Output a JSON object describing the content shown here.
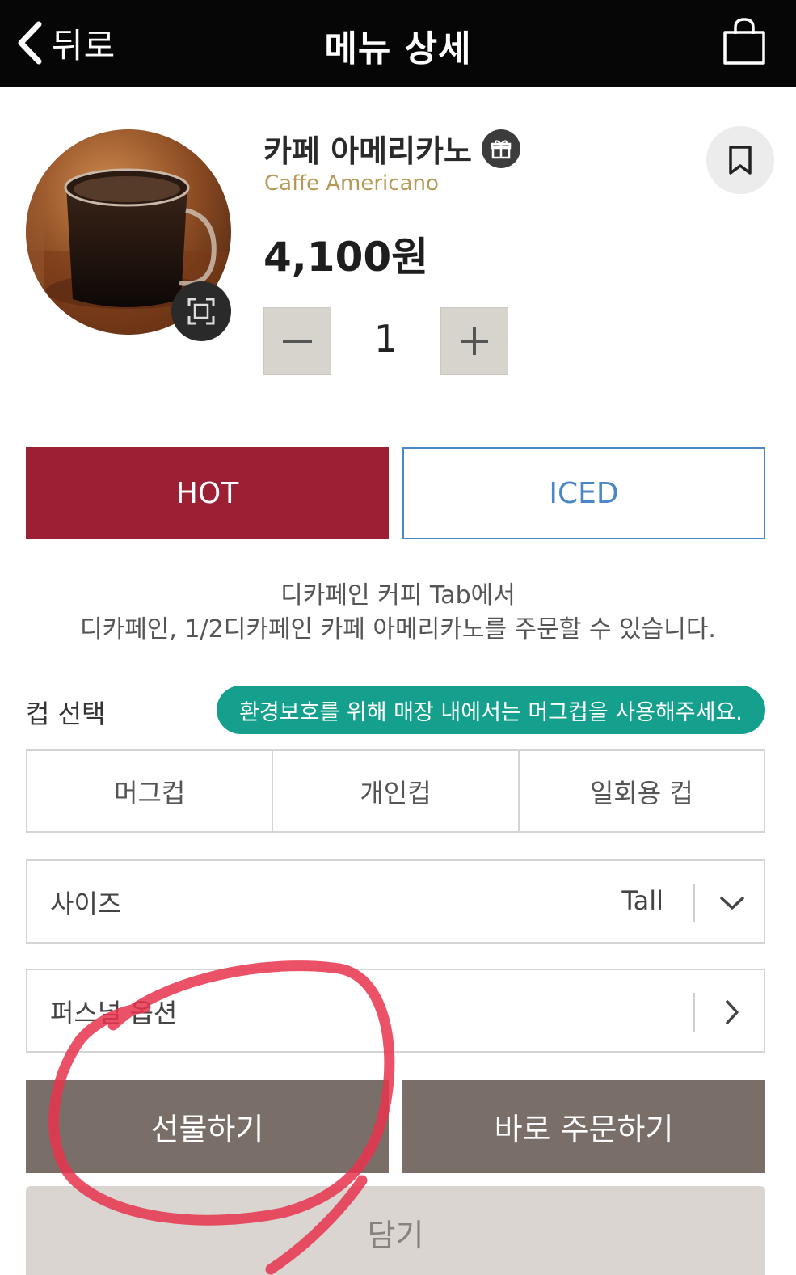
{
  "header": {
    "back_label": "뒤로",
    "title": "메뉴 상세"
  },
  "product": {
    "name_kr": "카페 아메리카노",
    "name_en": "Caffe Americano",
    "price": "4,100원",
    "quantity": "1"
  },
  "temperature": {
    "options": [
      "HOT",
      "ICED"
    ],
    "selected": "HOT"
  },
  "notice": {
    "line1": "디카페인 커피 Tab에서",
    "line2": "디카페인, 1/2디카페인 카페 아메리카노를 주문할 수 있습니다."
  },
  "cup": {
    "label": "컵 선택",
    "badge": "환경보호를 위해 매장 내에서는 머그컵을 사용해주세요.",
    "options": [
      "머그컵",
      "개인컵",
      "일회용 컵"
    ]
  },
  "size": {
    "label": "사이즈",
    "value": "Tall"
  },
  "personal_option": {
    "label": "퍼스널 옵션"
  },
  "actions": {
    "gift": "선물하기",
    "order": "바로 주문하기",
    "add_to_cart": "담기"
  },
  "colors": {
    "header_bg": "#060606",
    "hot_selected": "#9c1f33",
    "iced_border": "#4a86c8",
    "badge": "#14a08c",
    "action_btn": "#7a6e68",
    "annotation": "#e8344e"
  },
  "icons": [
    "chevron-left-icon",
    "shopping-bag-icon",
    "gift-icon",
    "bookmark-icon",
    "expand-icon",
    "minus-icon",
    "plus-icon",
    "chevron-down-icon",
    "chevron-right-icon"
  ]
}
